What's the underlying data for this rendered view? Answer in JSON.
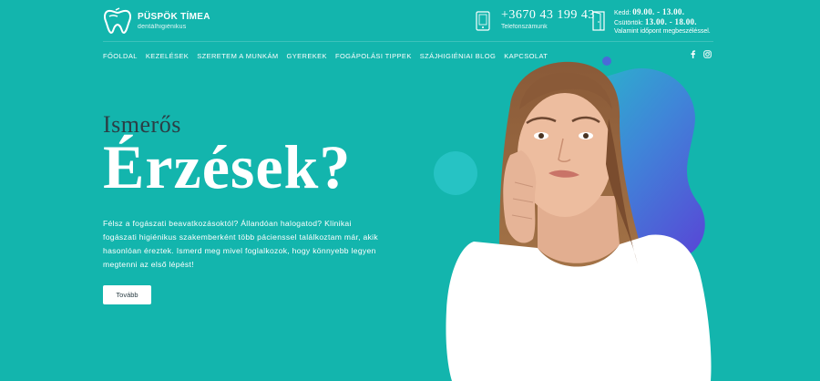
{
  "brand": {
    "name": "PÜSPÖK TÍMEA",
    "subtitle": "dentálhigiénikus"
  },
  "contact": {
    "phone": "+3670 43 199 43",
    "phone_label": "Telefonszámunk",
    "hours": [
      {
        "day": "Kedd:",
        "time": "09.00. - 13.00."
      },
      {
        "day": "Csütörtök:",
        "time": "13.00. - 18.00."
      }
    ],
    "hours_note": "Valamint időpont megbeszéléssel."
  },
  "nav": {
    "items": [
      {
        "label": "FŐOLDAL"
      },
      {
        "label": "KEZELÉSEK"
      },
      {
        "label": "SZERETEM A MUNKÁM"
      },
      {
        "label": "GYEREKEK"
      },
      {
        "label": "FOGÁPOLÁSI TIPPEK"
      },
      {
        "label": "SZÁJHIGIÉNIAI BLOG"
      },
      {
        "label": "KAPCSOLAT"
      }
    ]
  },
  "social": {
    "facebook": "facebook-icon",
    "instagram": "instagram-icon"
  },
  "hero": {
    "pretitle": "Ismerős",
    "title": "Érzések?",
    "body": "Félsz a fogászati beavatkozásoktól? Állandóan halogatod? Klinikai fogászati higiénikus szakemberként több pácienssel találkoztam már, akik hasonlóan éreztek. Ismerd meg mivel foglalkozok, hogy könnyebb legyen megtenni az első lépést!",
    "button": "Tovább"
  },
  "colors": {
    "background": "#13b5ad",
    "dark_text": "#2b3e45",
    "blob_purple": "#5b3fd6",
    "blob_teal": "#1ac6c4"
  }
}
